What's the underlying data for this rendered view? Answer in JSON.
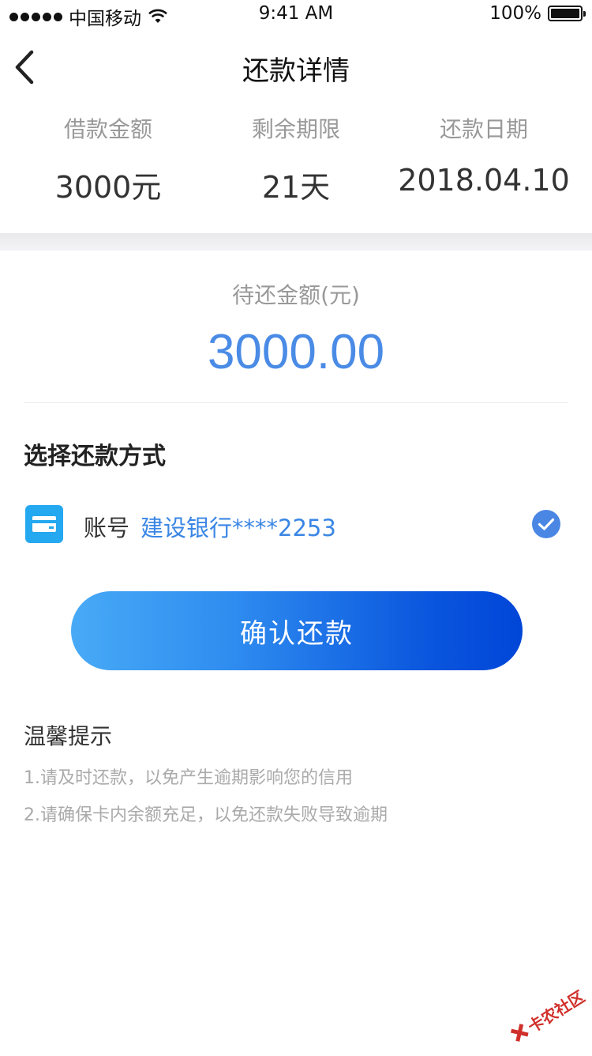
{
  "status_bar": {
    "carrier": "中国移动",
    "time": "9:41 AM",
    "battery": "100%"
  },
  "nav": {
    "title": "还款详情"
  },
  "summary": [
    {
      "label": "借款金额",
      "value": "3000元"
    },
    {
      "label": "剩余期限",
      "value": "21天"
    },
    {
      "label": "还款日期",
      "value": "2018.04.10"
    }
  ],
  "amount": {
    "label": "待还金额(元)",
    "value": "3000.00"
  },
  "payment_method": {
    "title": "选择还款方式",
    "account_label": "账号",
    "account_value": "建设银行****2253",
    "selected": true
  },
  "confirm_button": "确认还款",
  "tips": {
    "title": "温馨提示",
    "items": [
      "1.请及时还款，以免产生逾期影响您的信用",
      "2.请确保卡内余额充足，以免还款失败导致逾期"
    ]
  },
  "watermark": "卡农社区",
  "colors": {
    "accent": "#4a8be6",
    "button_start": "#48aaf6",
    "button_end": "#0046d8",
    "card_icon": "#24a8ef"
  }
}
